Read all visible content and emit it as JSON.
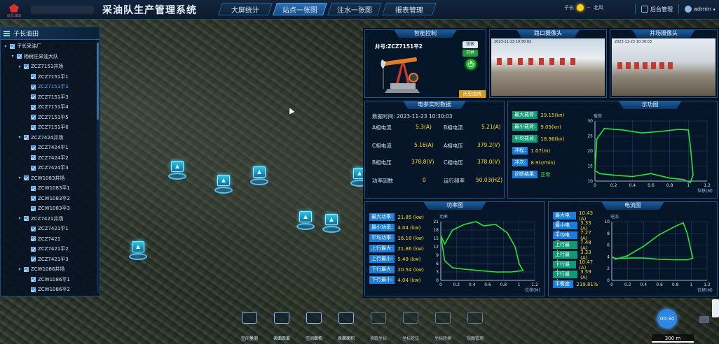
{
  "header": {
    "logo_text": "延长油田",
    "title": "采油队生产管理系统",
    "tabs": [
      {
        "label": "大屏统计",
        "active": false
      },
      {
        "label": "站点一张图",
        "active": true
      },
      {
        "label": "注水一张图",
        "active": false
      },
      {
        "label": "报表管理",
        "active": false
      }
    ],
    "weather_left": "子长",
    "weather_right": "北风",
    "backend_label": "后台管理",
    "user": "admin"
  },
  "tree": {
    "title": "子长油田",
    "items": [
      {
        "label": "子长采油厂",
        "level": 0,
        "caret": "▾",
        "selected": false
      },
      {
        "label": "杨树庄采油大队",
        "level": 1,
        "caret": "▾",
        "selected": false
      },
      {
        "label": "ZCZ7151井场",
        "level": 2,
        "caret": "▾",
        "selected": false
      },
      {
        "label": "ZCZ7151平1",
        "level": 3,
        "caret": "",
        "selected": false
      },
      {
        "label": "ZCZ7151平2",
        "level": 3,
        "caret": "",
        "selected": true
      },
      {
        "label": "ZCZ7151平3",
        "level": 3,
        "caret": "",
        "selected": false
      },
      {
        "label": "ZCZ7151平4",
        "level": 3,
        "caret": "",
        "selected": false
      },
      {
        "label": "ZCZ7151平5",
        "level": 3,
        "caret": "",
        "selected": false
      },
      {
        "label": "ZCZ7151平6",
        "level": 3,
        "caret": "",
        "selected": false
      },
      {
        "label": "ZCZ7424井场",
        "level": 2,
        "caret": "▾",
        "selected": false
      },
      {
        "label": "ZCZ7424平1",
        "level": 3,
        "caret": "",
        "selected": false
      },
      {
        "label": "ZCZ7424平2",
        "level": 3,
        "caret": "",
        "selected": false
      },
      {
        "label": "ZCZ7424平3",
        "level": 3,
        "caret": "",
        "selected": false
      },
      {
        "label": "ZCW1083井场",
        "level": 2,
        "caret": "▾",
        "selected": false
      },
      {
        "label": "ZCW1083平1",
        "level": 3,
        "caret": "",
        "selected": false
      },
      {
        "label": "ZCW1083平2",
        "level": 3,
        "caret": "",
        "selected": false
      },
      {
        "label": "ZCW1083平3",
        "level": 3,
        "caret": "",
        "selected": false
      },
      {
        "label": "ZCZ7421井场",
        "level": 2,
        "caret": "▾",
        "selected": false
      },
      {
        "label": "ZCZ7421平1",
        "level": 3,
        "caret": "",
        "selected": false
      },
      {
        "label": "ZCZ7421",
        "level": 3,
        "caret": "",
        "selected": false
      },
      {
        "label": "ZCZ7421平2",
        "level": 3,
        "caret": "",
        "selected": false
      },
      {
        "label": "ZCZ7421平3",
        "level": 3,
        "caret": "",
        "selected": false
      },
      {
        "label": "ZCW1086井场",
        "level": 2,
        "caret": "▾",
        "selected": false
      },
      {
        "label": "ZCW1086平1",
        "level": 3,
        "caret": "",
        "selected": false
      },
      {
        "label": "ZCW1086平2",
        "level": 3,
        "caret": "",
        "selected": false
      }
    ]
  },
  "control": {
    "title": "智能控制",
    "well_label": "井号:ZCZ7151平2",
    "lock_label": "锁表",
    "on_label": "开井",
    "history_label": "历史曲线"
  },
  "cameras": [
    {
      "title": "路口摄像头",
      "timestamp": "2023-11-23 10:30:02"
    },
    {
      "title": "井场摄像头",
      "timestamp": "2023-11-23 10:30:03"
    }
  ],
  "realtime": {
    "title": "电参实时数据",
    "time_label": "数据时间:",
    "time_value": "2023-11-23 10:30:03",
    "rows": [
      [
        {
          "k": "A相电流",
          "v": "5.3(A)"
        },
        {
          "k": "B相电流",
          "v": "5.21(A)"
        }
      ],
      [
        {
          "k": "C相电流",
          "v": "5.16(A)"
        },
        {
          "k": "A相电压",
          "v": "379.2(V)"
        }
      ],
      [
        {
          "k": "B相电压",
          "v": "378.8(V)"
        },
        {
          "k": "C相电压",
          "v": "378.0(V)"
        }
      ],
      [
        {
          "k": "功率因数",
          "v": "0"
        },
        {
          "k": "运行频率",
          "v": "50.03(HZ)"
        }
      ]
    ]
  },
  "dynamometer": {
    "title": "示功图",
    "badges": [
      {
        "k": "最大载荷:",
        "v": "29.15(kn)"
      },
      {
        "k": "最小载荷:",
        "v": "9.09(kn)"
      },
      {
        "k": "平均载荷:",
        "v": "18.96(kn)"
      },
      {
        "k": "冲程:",
        "v": "1.07(m)"
      },
      {
        "k": "冲次:",
        "v": "8.9(r/min)"
      },
      {
        "k": "诊断结果:",
        "v": "正常"
      }
    ],
    "ylabel": "载荷",
    "xlabel": "位移(M)"
  },
  "power": {
    "title": "功率图",
    "ylabel": "功率",
    "xlabel": "位移(M)",
    "badges": [
      {
        "k": "最大功率:",
        "v": "21.85 (kw)"
      },
      {
        "k": "最小功率:",
        "v": "4.04 (kw)"
      },
      {
        "k": "平均功率:",
        "v": "16.18 (kw)"
      },
      {
        "k": "上行最大:",
        "v": "21.86 (kw)"
      },
      {
        "k": "上行最小:",
        "v": "5.49 (kw)"
      },
      {
        "k": "下行最大:",
        "v": "20.54 (kw)"
      },
      {
        "k": "下行最小:",
        "v": "4.04 (kw)"
      }
    ]
  },
  "current": {
    "title": "电流图",
    "ylabel": "电流",
    "xlabel": "位移(M)",
    "badges": [
      {
        "k": "最大电流:",
        "v": "10.43 (A)"
      },
      {
        "k": "最小电流:",
        "v": "3.33 (A)"
      },
      {
        "k": "平均电流:",
        "v": "7.27 (A)"
      },
      {
        "k": "上行最大:",
        "v": "7.48 (A)"
      },
      {
        "k": "上行最小:",
        "v": "3.33 (A)"
      },
      {
        "k": "下行最大:",
        "v": "10.47 (A)"
      },
      {
        "k": "下行最小:",
        "v": "3.59 (A)"
      },
      {
        "k": "平衡度:",
        "v": "219.81%"
      }
    ]
  },
  "chart_data": [
    {
      "type": "line",
      "title": "示功图",
      "xlabel": "位移(M)",
      "ylabel": "载荷",
      "xlim": [
        0,
        1.2
      ],
      "ylim": [
        10,
        30
      ],
      "xticks": [
        0,
        0.2,
        0.4,
        0.6,
        0.8,
        1,
        1.2
      ],
      "yticks": [
        10,
        15,
        20,
        25,
        30
      ],
      "series": [
        {
          "x": [
            0.0,
            0.02,
            0.1,
            0.3,
            0.5,
            0.7,
            0.9,
            1.0,
            1.02,
            1.05,
            1.02,
            0.95,
            0.8,
            0.6,
            0.4,
            0.2,
            0.05,
            0.0
          ],
          "y": [
            13.5,
            24.0,
            27.5,
            27.0,
            26.0,
            26.5,
            27.2,
            27.0,
            22.0,
            12.0,
            9.5,
            10.5,
            11.0,
            12.5,
            11.5,
            12.0,
            12.5,
            13.5
          ]
        }
      ]
    },
    {
      "type": "line",
      "title": "功率图",
      "xlabel": "位移(M)",
      "ylabel": "功率",
      "xlim": [
        0,
        1.2
      ],
      "ylim": [
        0,
        21
      ],
      "xticks": [
        0,
        0.2,
        0.4,
        0.6,
        0.8,
        1,
        1.2
      ],
      "yticks": [
        0,
        3,
        6,
        9,
        12,
        15,
        18,
        21
      ],
      "series": [
        {
          "x": [
            0.0,
            0.05,
            0.15,
            0.3,
            0.45,
            0.55,
            0.7,
            0.85,
            0.95,
            1.0,
            1.05,
            0.9,
            0.7,
            0.5,
            0.3,
            0.15,
            0.05,
            0.0
          ],
          "y": [
            16.0,
            13.0,
            18.0,
            20.0,
            21.0,
            19.5,
            20.0,
            17.0,
            12.0,
            6.0,
            3.5,
            3.0,
            3.0,
            3.5,
            4.0,
            4.5,
            7.0,
            16.0
          ]
        }
      ]
    },
    {
      "type": "line",
      "title": "电流图",
      "xlabel": "位移(M)",
      "ylabel": "电流",
      "xlim": [
        0,
        1.2
      ],
      "ylim": [
        0,
        10
      ],
      "xticks": [
        0,
        0.2,
        0.4,
        0.6,
        0.8,
        1,
        1.2
      ],
      "yticks": [
        0,
        2,
        4,
        6,
        8,
        10
      ],
      "series": [
        {
          "x": [
            0.0,
            0.05,
            0.2,
            0.4,
            0.6,
            0.8,
            0.9,
            0.95,
            1.0,
            1.02,
            0.95,
            0.8,
            0.6,
            0.4,
            0.2,
            0.05,
            0.0
          ],
          "y": [
            4.0,
            3.6,
            4.2,
            5.8,
            7.8,
            9.2,
            9.8,
            8.0,
            5.0,
            3.8,
            3.5,
            3.5,
            3.6,
            3.8,
            3.8,
            3.7,
            4.0
          ]
        }
      ]
    }
  ],
  "toolbar": [
    {
      "label": "空间量测",
      "icon": "measure-icon",
      "dim": false
    },
    {
      "label": "表面距离",
      "icon": "ruler-icon",
      "dim": false
    },
    {
      "label": "空间面积",
      "icon": "area-icon",
      "dim": false
    },
    {
      "label": "表面面积",
      "icon": "surface-icon",
      "dim": false
    },
    {
      "label": "拾取坐标",
      "icon": "pick-icon",
      "dim": true
    },
    {
      "label": "坐标定位",
      "icon": "locate-icon",
      "dim": true
    },
    {
      "label": "坐标转换",
      "icon": "convert-icon",
      "dim": true
    },
    {
      "label": "视图管理",
      "icon": "view-icon",
      "dim": true
    }
  ],
  "timer": "00:34",
  "scale": "300 m"
}
